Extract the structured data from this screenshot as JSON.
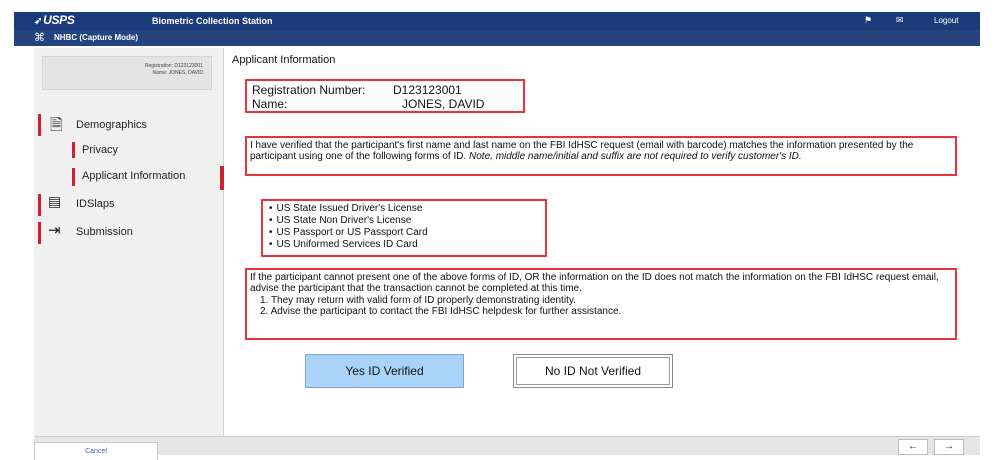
{
  "titlebar": {
    "brand": "USPS",
    "title": "Biometric Collection Station",
    "logout": "Logout"
  },
  "modebar": {
    "label": "NHBC (Capture Mode)"
  },
  "sidebar": {
    "registration_line": "Registration: D123123001",
    "name_line": "Name: JONES, DAVID",
    "items": [
      {
        "label": "Demographics",
        "icon": "document-icon"
      },
      {
        "label": "IDSlaps",
        "icon": "fingerprint-scanner-icon"
      },
      {
        "label": "Submission",
        "icon": "export-icon"
      }
    ],
    "subitems": [
      {
        "label": "Privacy"
      },
      {
        "label": "Applicant Information"
      }
    ],
    "cancel_label": "Cancel"
  },
  "main": {
    "title": "Applicant Information",
    "registration_label": "Registration Number:",
    "registration_value": "D123123001",
    "name_label": "Name:",
    "name_value": "JONES, DAVID",
    "verify_text": "I have verified that the participant's first name and last name on the FBI IdHSC request (email with barcode) matches the information presented by the participant using one of the following forms of ID.",
    "verify_note": "Note, middle name/initial and suffix are not required to verify customer's ID.",
    "id_list": [
      "US State Issued Driver's License",
      "US State Non Driver's License",
      "US Passport or US Passport Card",
      "US Uniformed Services ID Card"
    ],
    "fallback_text": "If the participant cannot present one of the above forms of ID, OR the information on the ID does not match the information on the FBI IdHSC request email, advise the participant that the transaction cannot be completed at this time.",
    "fallback_steps": [
      "1. They may return with valid form of ID properly demonstrating identity.",
      "2. Advise the participant to contact the FBI IdHSC helpdesk for further assistance."
    ],
    "yes_label": "Yes ID Verified",
    "no_label": "No ID Not Verified"
  },
  "footer": {
    "back_label": "←",
    "next_label": "→"
  }
}
